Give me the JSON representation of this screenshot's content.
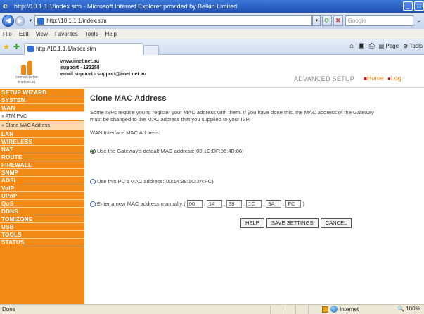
{
  "browser": {
    "title": "http://10.1.1.1/index.stm - Microsoft Internet Explorer provided by Belkin Limited",
    "address": "http://10.1.1.1/index.stm",
    "search_placeholder": "Google",
    "menu": [
      "File",
      "Edit",
      "View",
      "Favorites",
      "Tools",
      "Help"
    ],
    "tab_label": "http://10.1.1.1/index.stm",
    "commands": {
      "page": "Page",
      "tools": "Tools"
    },
    "status_text": "Done",
    "zone": "Internet",
    "zoom": "100%"
  },
  "header": {
    "logo_tag_1": "connect better",
    "logo_tag_2": "iinet.net.au",
    "site": "www.iinet.net.au",
    "support": "support - 132258",
    "email": "email support - support@iinet.net.au",
    "advanced": "ADVANCED SETUP",
    "home": "Home",
    "logout": "Log"
  },
  "sidebar": {
    "items": [
      {
        "label": "SETUP WIZARD"
      },
      {
        "label": "SYSTEM"
      },
      {
        "label": "WAN"
      },
      {
        "label": "» ATM PVC",
        "sub": true
      },
      {
        "label": "» Clone MAC Address",
        "sub": true,
        "active": true
      },
      {
        "label": "LAN"
      },
      {
        "label": "WIRELESS"
      },
      {
        "label": "NAT"
      },
      {
        "label": "ROUTE"
      },
      {
        "label": "FIREWALL"
      },
      {
        "label": "SNMP"
      },
      {
        "label": "ADSL"
      },
      {
        "label": "VoIP"
      },
      {
        "label": "UPnP"
      },
      {
        "label": "QoS"
      },
      {
        "label": "DDNS"
      },
      {
        "label": "TOMIZONE"
      },
      {
        "label": "USB"
      },
      {
        "label": "TOOLS"
      },
      {
        "label": "STATUS"
      }
    ]
  },
  "main": {
    "title": "Clone MAC Address",
    "desc_line1": "Some ISPs require you to register your MAC address with them. If you have done this, the MAC address of the Gateway",
    "desc_line2": "must be changed to the MAC address that you supplied to your ISP.",
    "subhead": "WAN Interface MAC Address:",
    "opt_default": "Use the Gateway's default MAC address:(00:1C:DF:06:4B:86)",
    "opt_pc": "Use this PC's MAC address:(00:14:38:1C:3A:FC)",
    "opt_manual": "Enter a new MAC address manually:(",
    "manual_close": ")",
    "mac_fields": [
      "00",
      "14",
      "38",
      "1C",
      "3A",
      "FC"
    ],
    "selected_option": "default",
    "buttons": {
      "help": "HELP",
      "save": "SAVE SETTINGS",
      "cancel": "CANCEL"
    }
  },
  "colors": {
    "accent": "#f28a17",
    "bullet": "#d8161c"
  }
}
